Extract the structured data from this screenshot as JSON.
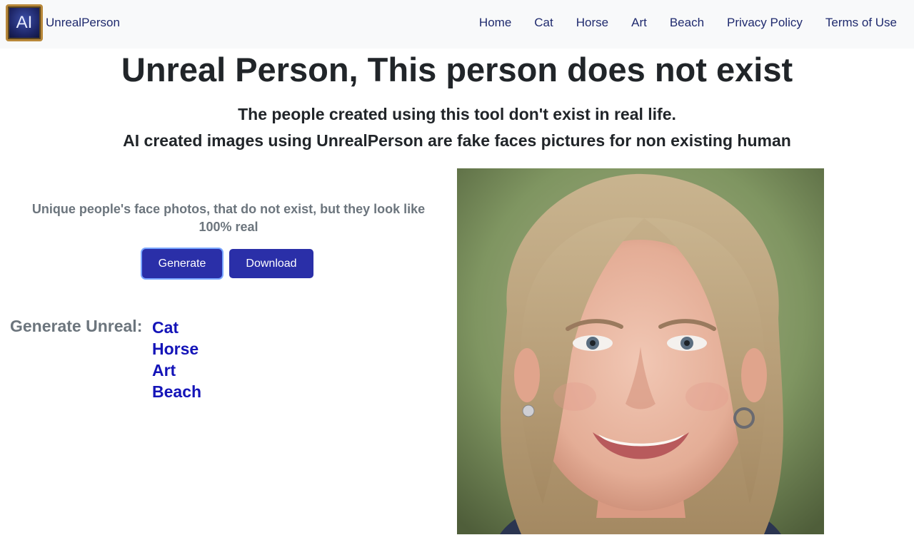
{
  "brand": {
    "logo_text": "AI",
    "name": "UnrealPerson"
  },
  "nav": [
    {
      "label": "Home"
    },
    {
      "label": "Cat"
    },
    {
      "label": "Horse"
    },
    {
      "label": "Art"
    },
    {
      "label": "Beach"
    },
    {
      "label": "Privacy Policy"
    },
    {
      "label": "Terms of Use"
    }
  ],
  "hero": {
    "title": "Unreal Person, This person does not exist",
    "subtitle_1": "The people created using this tool don't exist in real life.",
    "subtitle_2": "AI created images using UnrealPerson are fake faces pictures for non existing human"
  },
  "panel": {
    "tagline": "Unique people's face photos, that do not exist, but they look like 100% real",
    "generate_label": "Generate",
    "download_label": "Download"
  },
  "generate_unreal": {
    "label": "Generate Unreal:",
    "links": [
      {
        "label": "Cat"
      },
      {
        "label": "Horse"
      },
      {
        "label": "Art"
      },
      {
        "label": "Beach"
      }
    ]
  },
  "colors": {
    "navbar_bg": "#f8f9fa",
    "nav_text": "#1f2a6e",
    "button_bg": "#2a2fa8",
    "link_blue": "#1414b8",
    "muted_text": "#6c757d"
  },
  "icons": {
    "logo": "ai-logo-icon"
  }
}
